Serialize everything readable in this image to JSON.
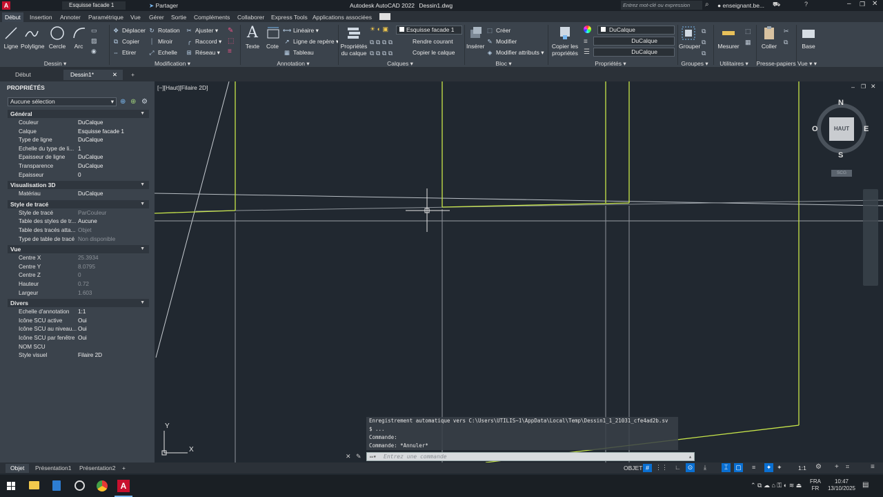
{
  "app": {
    "title": "Autodesk AutoCAD 2022",
    "document": "Dessin1.dwg",
    "qat_layer": "Esquisse facade 1",
    "share_label": "Partager",
    "search_placeholder": "Entrez mot-clé ou expression",
    "user": "enseignant.be..."
  },
  "ribbon_tabs": [
    "Début",
    "Insertion",
    "Annoter",
    "Paramétrique",
    "Vue",
    "Gérer",
    "Sortie",
    "Compléments",
    "Collaborer",
    "Express Tools",
    "Applications associées"
  ],
  "ribbon": {
    "dessin": {
      "title": "Dessin",
      "tools": [
        "Ligne",
        "Polyligne",
        "Cercle",
        "Arc"
      ]
    },
    "modification": {
      "title": "Modification",
      "tools": [
        "Déplacer",
        "Rotation",
        "Ajuster",
        "Copier",
        "Miroir",
        "Raccord",
        "Etirer",
        "Echelle",
        "Réseau"
      ]
    },
    "annotation": {
      "title": "Annotation",
      "big": [
        "Texte",
        "Cote"
      ],
      "small": [
        "Linéaire",
        "Ligne de repère",
        "Tableau"
      ]
    },
    "calques": {
      "title": "Calques",
      "big": "Propriétés du calque",
      "combo": "Esquisse facade 1",
      "small": [
        "Rendre courant",
        "Copier le calque"
      ]
    },
    "bloc": {
      "title": "Bloc",
      "big": "Insérer",
      "small": [
        "Créer",
        "Modifier",
        "Modifier attributs"
      ]
    },
    "proprietes": {
      "title": "Propriétés",
      "big": "Copier les propriétés",
      "combos": [
        "DuCalque",
        "DuCalque",
        "DuCalque"
      ]
    },
    "groupes": {
      "title": "Groupes",
      "big": "Grouper"
    },
    "utilitaires": {
      "title": "Utilitaires",
      "big": "Mesurer"
    },
    "presse_papiers": {
      "title": "Presse-papiers",
      "big": "Coller"
    },
    "vue": {
      "title": "Vue",
      "big": "Base"
    }
  },
  "doc_tabs": [
    "Début",
    "Dessin1*"
  ],
  "properties_panel": {
    "title": "PROPRIÉTÉS",
    "selection": "Aucune sélection",
    "sections": [
      {
        "name": "Général",
        "rows": [
          {
            "k": "Couleur",
            "v": "DuCalque"
          },
          {
            "k": "Calque",
            "v": "Esquisse facade 1"
          },
          {
            "k": "Type de ligne",
            "v": "DuCalque"
          },
          {
            "k": "Echelle du type de li...",
            "v": "1"
          },
          {
            "k": "Epaisseur de ligne",
            "v": "DuCalque"
          },
          {
            "k": "Transparence",
            "v": "DuCalque"
          },
          {
            "k": "Epaisseur",
            "v": "0"
          }
        ]
      },
      {
        "name": "Visualisation 3D",
        "rows": [
          {
            "k": "Matériau",
            "v": "DuCalque"
          }
        ]
      },
      {
        "name": "Style de tracé",
        "rows": [
          {
            "k": "Style de tracé",
            "v": "ParCouleur",
            "dim": true
          },
          {
            "k": "Table des styles de tr...",
            "v": "Aucune"
          },
          {
            "k": "Table des tracés atta...",
            "v": "Objet",
            "dim": true
          },
          {
            "k": "Type de table de tracé",
            "v": "Non disponible",
            "dim": true
          }
        ]
      },
      {
        "name": "Vue",
        "rows": [
          {
            "k": "Centre X",
            "v": "25.3934",
            "dim": true
          },
          {
            "k": "Centre Y",
            "v": "8.0795",
            "dim": true
          },
          {
            "k": "Centre Z",
            "v": "0",
            "dim": true
          },
          {
            "k": "Hauteur",
            "v": "0.72",
            "dim": true
          },
          {
            "k": "Largeur",
            "v": "1.603",
            "dim": true
          }
        ]
      },
      {
        "name": "Divers",
        "rows": [
          {
            "k": "Echelle d'annotation",
            "v": "1:1"
          },
          {
            "k": "Icône SCU active",
            "v": "Oui"
          },
          {
            "k": "Icône SCU au niveau...",
            "v": "Oui"
          },
          {
            "k": "Icône SCU par fenêtre",
            "v": "Oui"
          },
          {
            "k": "NOM SCU",
            "v": ""
          },
          {
            "k": "Style visuel",
            "v": "Filaire 2D"
          }
        ]
      }
    ]
  },
  "viewport": {
    "label": "[−][Haut][Filaire 2D]",
    "viewcube": {
      "n": "N",
      "s": "S",
      "e": "E",
      "w": "O",
      "face": "HAUT",
      "ucs": "SCG"
    },
    "ucs_x": "X",
    "ucs_y": "Y"
  },
  "command": {
    "history": [
      "Enregistrement automatique vers C:\\Users\\UTILIS~1\\AppData\\Local\\Temp\\Dessin1_1_21031_cfe4ad2b.sv",
      "$ ...",
      "Commande:",
      "Commande: *Annuler*"
    ],
    "placeholder": "Entrez une commande"
  },
  "layout_tabs": [
    "Objet",
    "Présentation1",
    "Présentation2"
  ],
  "status": {
    "space": "OBJET",
    "scale": "1:1"
  },
  "taskbar": {
    "lang": "FRA",
    "lang2": "FR",
    "time": "10:47",
    "date": "13/10/2025"
  },
  "colors": {
    "accent": "#0a6fd1",
    "geometry": "#c8e64a",
    "background": "#212830"
  }
}
